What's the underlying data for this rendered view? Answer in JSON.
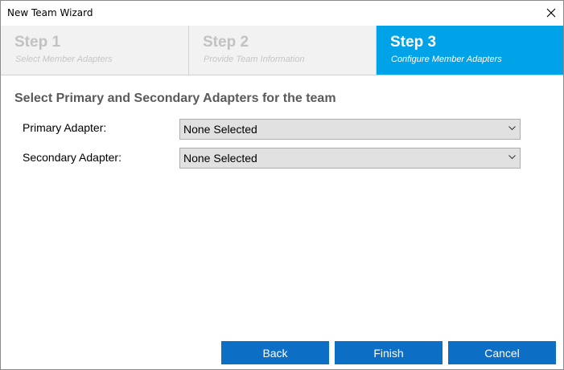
{
  "window": {
    "title": "New Team Wizard"
  },
  "steps": [
    {
      "number": "Step 1",
      "subtitle": "Select Member Adapters",
      "active": false
    },
    {
      "number": "Step 2",
      "subtitle": "Provide Team Information",
      "active": false
    },
    {
      "number": "Step 3",
      "subtitle": "Configure Member Adapters",
      "active": true
    }
  ],
  "section": {
    "title": "Select Primary and Secondary Adapters for the team"
  },
  "primary": {
    "label": "Primary Adapter:",
    "value": "None Selected"
  },
  "secondary": {
    "label": "Secondary Adapter:",
    "value": "None Selected"
  },
  "buttons": {
    "back": "Back",
    "finish": "Finish",
    "cancel": "Cancel"
  },
  "colors": {
    "active_step": "#00a2e8",
    "button": "#0c6ec5"
  }
}
